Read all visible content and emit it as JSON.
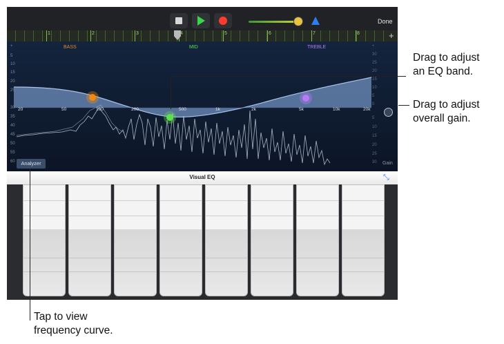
{
  "toolbar": {
    "done_label": "Done",
    "ruler_bars": [
      "1",
      "2",
      "3",
      "4",
      "5",
      "6",
      "7",
      "8"
    ],
    "ruler_plus": "+",
    "icons": {
      "stop": "stop-icon",
      "play": "play-icon",
      "record": "record-icon",
      "metronome": "metronome-icon",
      "volume": "volume-slider"
    }
  },
  "eq": {
    "bands": {
      "bass": "BASS",
      "mid": "MID",
      "treble": "TREBLE"
    },
    "band_colors": {
      "bass": "#f08a12",
      "mid": "#5ee04e",
      "treble": "#b77cf5"
    },
    "freq_labels": [
      "20",
      "50",
      "100",
      "200",
      "500",
      "1k",
      "2k",
      "5k",
      "10k",
      "20k"
    ],
    "left_axis": [
      "+",
      "5",
      "10",
      "15",
      "20",
      "25",
      "30",
      "35",
      "40",
      "45",
      "50",
      "55",
      "60"
    ],
    "right_axis": [
      "+",
      "30",
      "25",
      "20",
      "15",
      "10",
      "5",
      "0",
      "5",
      "10",
      "15",
      "20",
      "25",
      "30"
    ],
    "gain_label": "Gain",
    "analyzer_button": "Analyzer"
  },
  "visual_eq": {
    "title": "Visual EQ"
  },
  "callouts": {
    "band_line1": "Drag to adjust",
    "band_line2": "an EQ band.",
    "gain_line1": "Drag to adjust",
    "gain_line2": "overall gain.",
    "analyzer_line1": "Tap to view",
    "analyzer_line2": "frequency curve."
  }
}
